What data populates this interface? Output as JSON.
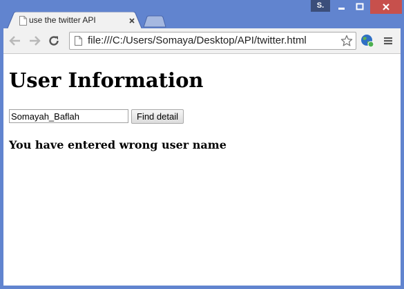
{
  "browser": {
    "profile_initial": "S.",
    "tab": {
      "title": "use the twitter API"
    },
    "address_bar": {
      "url": "file:///C:/Users/Somaya/Desktop/API/twitter.html"
    }
  },
  "page": {
    "heading": "User Information",
    "username_input": {
      "value": "Somayah_Baflah"
    },
    "find_button_label": "Find detail",
    "error_message": "You have entered wrong user name"
  },
  "colors": {
    "frame": "#6184cf",
    "close_button": "#c7504c",
    "toolbar": "#f1f1f1"
  }
}
